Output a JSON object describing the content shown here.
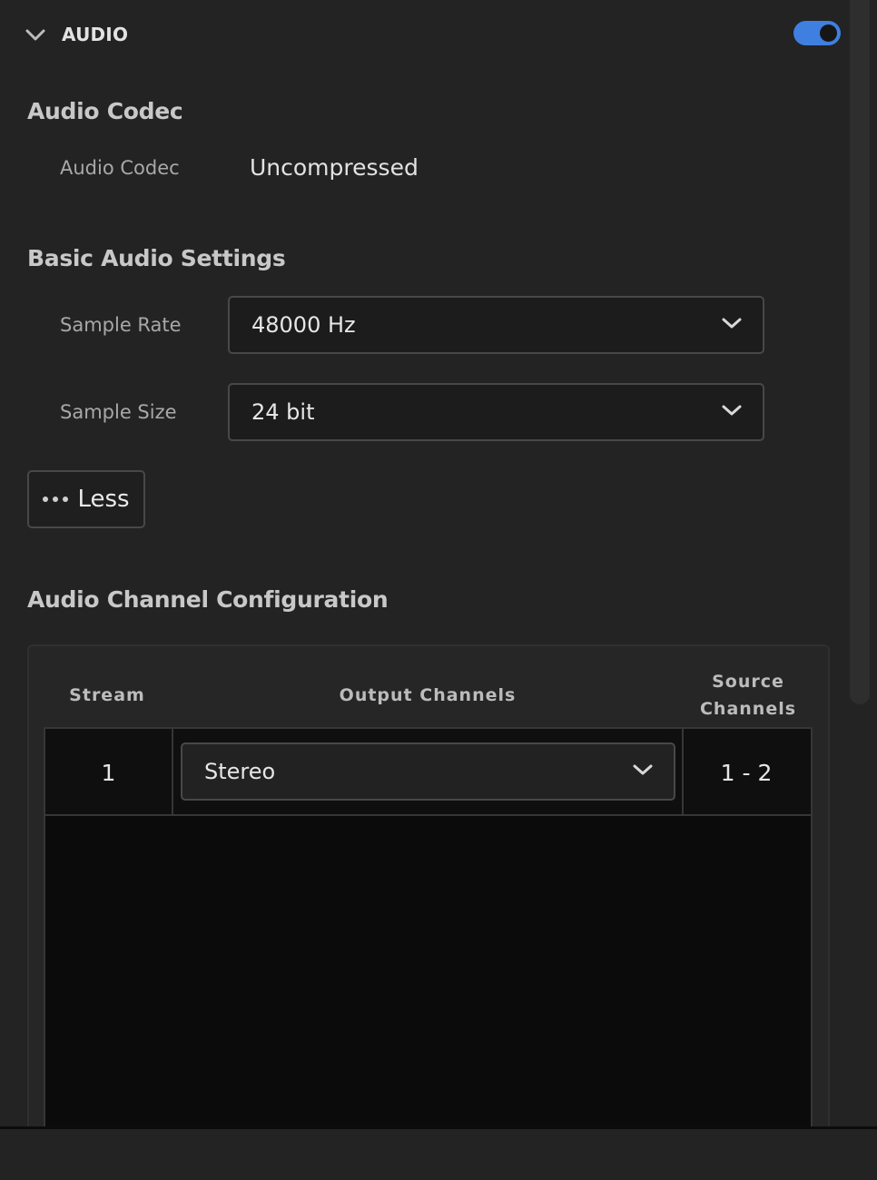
{
  "section": {
    "title": "AUDIO",
    "enabled": true
  },
  "codec": {
    "heading": "Audio Codec",
    "label": "Audio Codec",
    "value": "Uncompressed"
  },
  "basic": {
    "heading": "Basic Audio Settings",
    "sample_rate_label": "Sample Rate",
    "sample_rate_value": "48000 Hz",
    "sample_size_label": "Sample Size",
    "sample_size_value": "24 bit"
  },
  "less_button": {
    "label": "Less"
  },
  "channels": {
    "heading": "Audio Channel Configuration",
    "columns": {
      "stream": "Stream",
      "output": "Output Channels",
      "source_line1": "Source",
      "source_line2": "Channels"
    },
    "rows": [
      {
        "stream": "1",
        "output": "Stereo",
        "source": "1 - 2"
      }
    ]
  },
  "colors": {
    "accent": "#3f7fe0",
    "background": "#232323"
  }
}
